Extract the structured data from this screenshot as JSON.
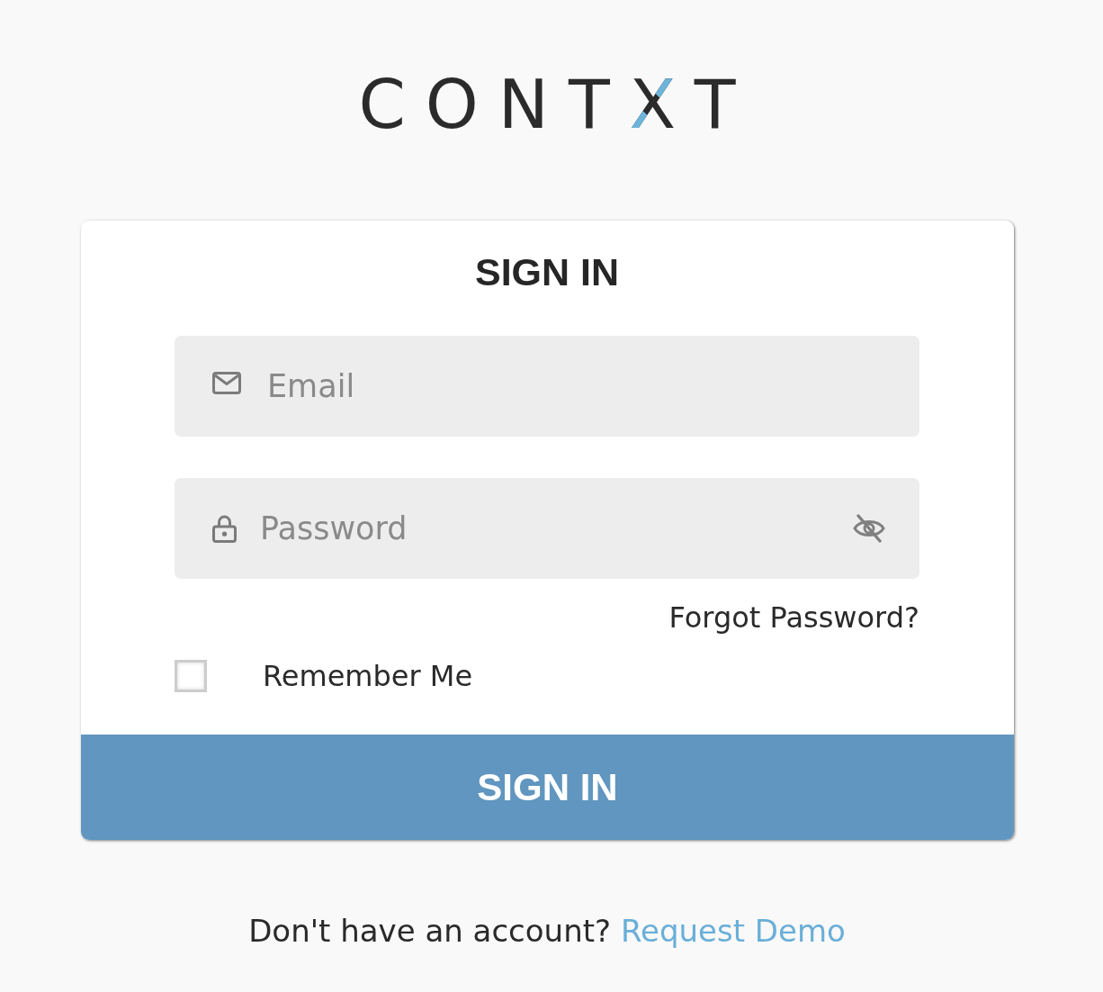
{
  "logo": {
    "text": "CONTXT"
  },
  "form": {
    "title": "SIGN IN",
    "fields": [
      {
        "kind": "email",
        "placeholder": "Email"
      },
      {
        "kind": "password",
        "placeholder": "Password",
        "visible": false
      }
    ],
    "forgot_link": "Forgot Password?",
    "remember": {
      "label": "Remember Me",
      "checked": false
    },
    "submit": "SIGN IN"
  },
  "footer": {
    "prompt": "Don't have an account?",
    "link": "Request Demo"
  }
}
